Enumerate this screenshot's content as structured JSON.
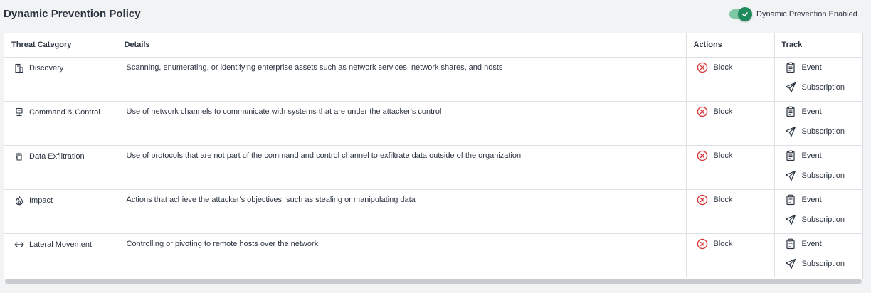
{
  "header": {
    "title": "Dynamic Prevention Policy",
    "toggle_label": "Dynamic Prevention Enabled",
    "toggle_on": true
  },
  "table": {
    "columns": [
      "Threat Category",
      "Details",
      "Actions",
      "Track"
    ],
    "rows": [
      {
        "category": "Discovery",
        "icon": "building-icon",
        "details": "Scanning, enumerating, or identifying enterprise assets such as network services, network shares, and hosts",
        "action": "Block",
        "track": [
          "Event",
          "Subscription"
        ]
      },
      {
        "category": "Command & Control",
        "icon": "monitor-icon",
        "details": "Use of network channels to communicate with systems that are under the attacker's control",
        "action": "Block",
        "track": [
          "Event",
          "Subscription"
        ]
      },
      {
        "category": "Data Exfiltration",
        "icon": "hand-icon",
        "details": "Use of protocols that are not part of the command and control channel to exfiltrate data outside of the organization",
        "action": "Block",
        "track": [
          "Event",
          "Subscription"
        ]
      },
      {
        "category": "Impact",
        "icon": "fire-icon",
        "details": "Actions that achieve the attacker's objectives, such as stealing or manipulating data",
        "action": "Block",
        "track": [
          "Event",
          "Subscription"
        ]
      },
      {
        "category": "Lateral Movement",
        "icon": "arrows-horizontal-icon",
        "details": "Controlling or pivoting to remote hosts over the network",
        "action": "Block",
        "track": [
          "Event",
          "Subscription"
        ]
      }
    ]
  },
  "colors": {
    "toggle_accent": "#1f8a5b",
    "toggle_track": "#7fc8a6",
    "block_red": "#d93a3a",
    "text": "#2b3441"
  }
}
